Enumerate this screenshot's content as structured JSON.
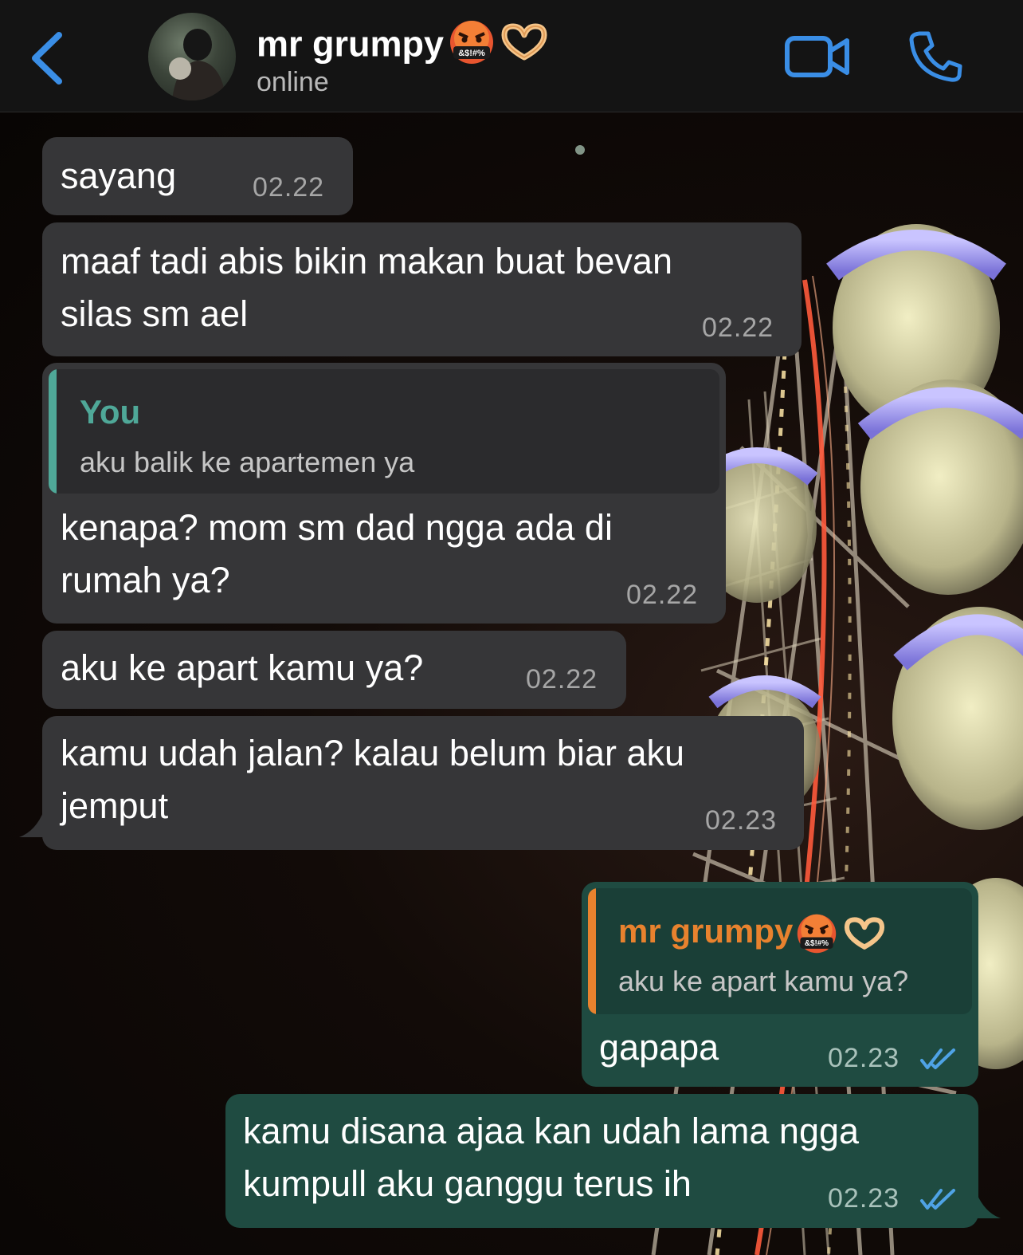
{
  "header": {
    "back_icon": "chevron-left-icon",
    "contact_name": "mr grumpy",
    "contact_emojis": [
      "cursing-face-emoji",
      "heart-hands-emoji"
    ],
    "status": "online",
    "video_icon": "video-camera-icon",
    "call_icon": "phone-icon",
    "accent_color": "#3a8ee6"
  },
  "messages": [
    {
      "direction": "incoming",
      "text": "sayang",
      "time": "02.22"
    },
    {
      "direction": "incoming",
      "lines": [
        "maaf tadi abis bikin makan buat bevan",
        "silas sm ael"
      ],
      "time": "02.22"
    },
    {
      "direction": "incoming",
      "quote": {
        "author": "You",
        "text": "aku balik ke apartemen ya"
      },
      "lines": [
        "kenapa? mom sm dad ngga ada di",
        "rumah ya?"
      ],
      "time": "02.22"
    },
    {
      "direction": "incoming",
      "text": "aku ke apart kamu ya?",
      "time": "02.22"
    },
    {
      "direction": "incoming",
      "lines": [
        "kamu udah jalan? kalau belum biar aku",
        "jemput"
      ],
      "time": "02.23"
    },
    {
      "direction": "outgoing",
      "quote": {
        "author": "mr grumpy",
        "text": "aku ke apart kamu ya?"
      },
      "text": "gapapa",
      "time": "02.23",
      "status": "read"
    },
    {
      "direction": "outgoing",
      "lines": [
        "kamu disana ajaa kan udah lama ngga",
        "kumpull aku ganggu terus ih"
      ],
      "time": "02.23",
      "status": "read"
    }
  ],
  "colors": {
    "incoming_bubble": "#363638",
    "outgoing_bubble": "#1f4b41",
    "quote_you": "#4fa898",
    "quote_contact": "#e8822e",
    "read_ticks": "#4fa3e6"
  }
}
